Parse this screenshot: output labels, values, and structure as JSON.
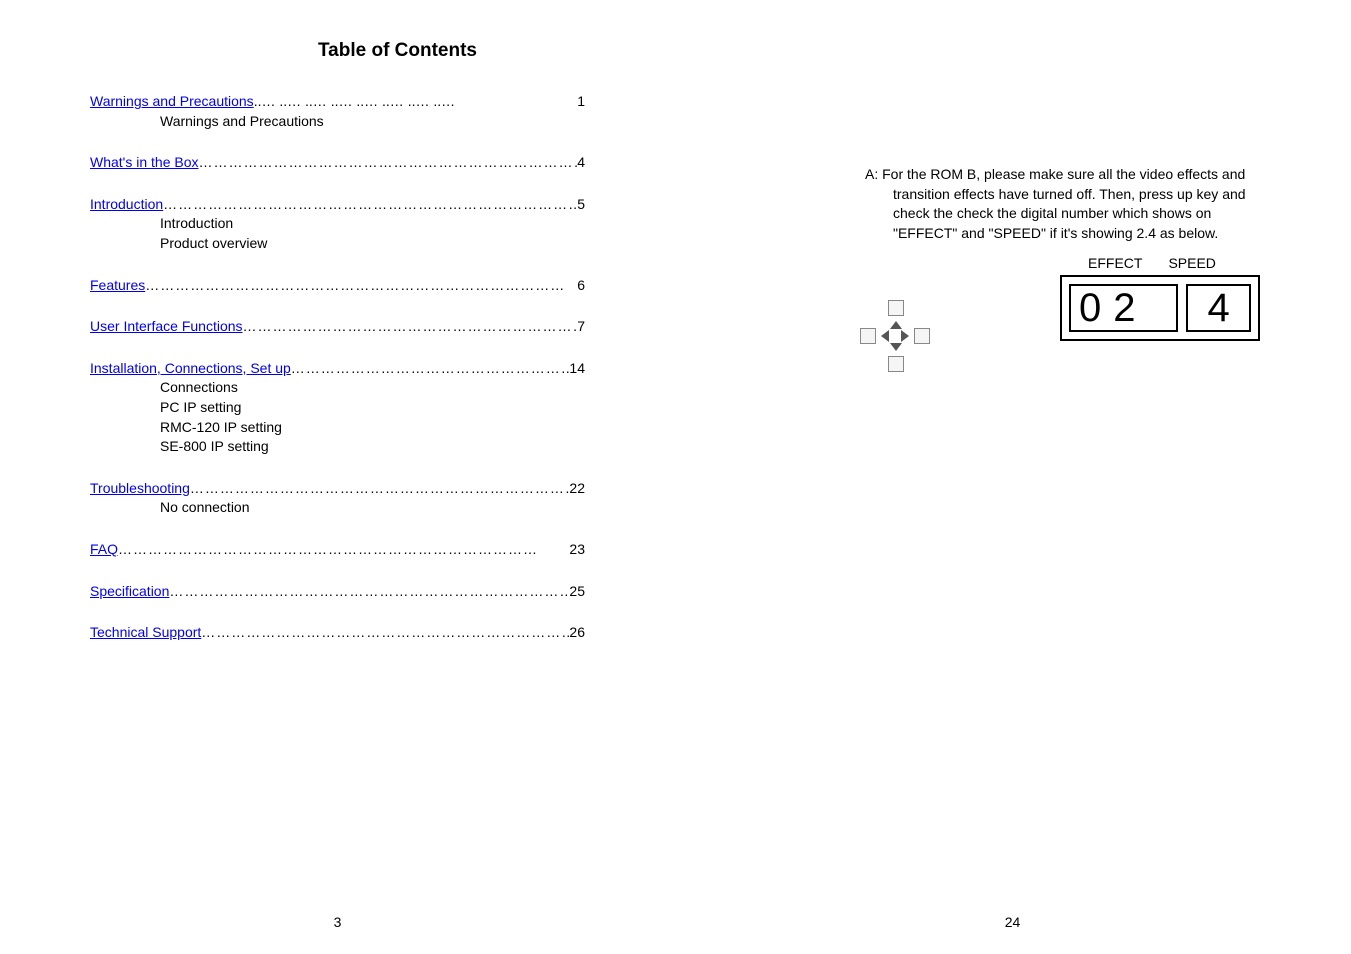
{
  "left": {
    "title": "Table of Contents",
    "entries": [
      {
        "link": "Warnings and Precautions",
        "page": "1",
        "subs": [
          "Warnings and Precautions"
        ],
        "dot_style": "space"
      },
      {
        "link": "What's in the Box",
        "page": "4",
        "subs": []
      },
      {
        "link": "Introduction",
        "page": "5",
        "subs": [
          "Introduction",
          "Product overview"
        ]
      },
      {
        "link": "Features",
        "page": "6",
        "subs": []
      },
      {
        "link": "User Interface Functions",
        "page": "7",
        "subs": []
      },
      {
        "link": "Installation, Connections, Set up",
        "page": "14",
        "subs": [
          "Connections",
          "PC IP setting",
          "RMC-120 IP setting",
          "SE-800 IP setting"
        ]
      },
      {
        "link": "Troubleshooting",
        "page": "22",
        "subs": [
          "No connection"
        ]
      },
      {
        "link": "FAQ",
        "page": "23",
        "subs": []
      },
      {
        "link": "Specification",
        "page": "25",
        "subs": []
      },
      {
        "link": "Technical Support",
        "page": "26",
        "subs": []
      }
    ],
    "page_num": "3"
  },
  "right": {
    "paragraph_prefix": "A: ",
    "paragraph_line1": "For the ROM B, please make sure all the video effects and",
    "paragraph_line2": "transition effects have turned off. Then, press up key and",
    "paragraph_line3": "check the  check the digital number which shows on",
    "paragraph_line4": "\"EFFECT\" and \"SPEED\" if it's showing 2.4 as below.",
    "labels": {
      "effect": "EFFECT",
      "speed": "SPEED"
    },
    "digits": {
      "d1": "0",
      "d2": "2",
      "d3": "4"
    },
    "page_num": "24"
  }
}
